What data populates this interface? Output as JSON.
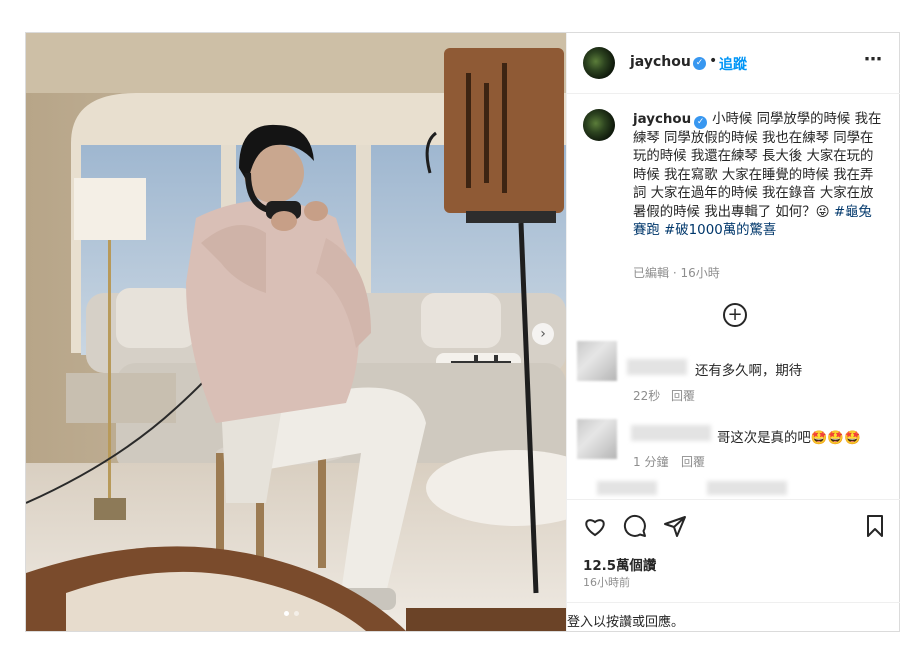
{
  "post": {
    "username": "jaychou",
    "separator": "•",
    "follow_label": "追蹤",
    "more_icon": "⋯",
    "caption_parts": [
      "小時候 同學放學的時候 我在練琴 同學放假的時候 我也在練琴 同學在玩的時候 我還在練琴 長大後 大家在玩的時候 我在寫歌 大家在睡覺的時候 我在弄詞 大家在過年的時候 我在錄音 大家在放暑假的時候 我出專輯了 如何？😜 "
    ],
    "hashtag_1": "#龜兔賽跑",
    "hashtag_2": "#破1000萬的驚喜",
    "edited_meta": "已編輯 · 16小時",
    "load_more_icon": "+",
    "likes": "12.5萬個讚",
    "posted_time": "16小時前",
    "login_prompt": "登入以按讚或回應。"
  },
  "comments": [
    {
      "text": "还有多久啊，期待",
      "time": "22秒",
      "reply": "回覆"
    },
    {
      "text": "哥这次是真的吧🤩🤩🤩",
      "time": "1 分鐘",
      "reply": "回覆"
    }
  ],
  "colors": {
    "accent": "#0095f6",
    "verified": "#3897f0",
    "hashtag": "#00376b",
    "muted": "#8e8e8e"
  },
  "icons": {
    "like": "heart-icon",
    "comment": "comment-icon",
    "share": "share-icon",
    "save": "bookmark-icon",
    "next": "chevron-right-icon"
  }
}
